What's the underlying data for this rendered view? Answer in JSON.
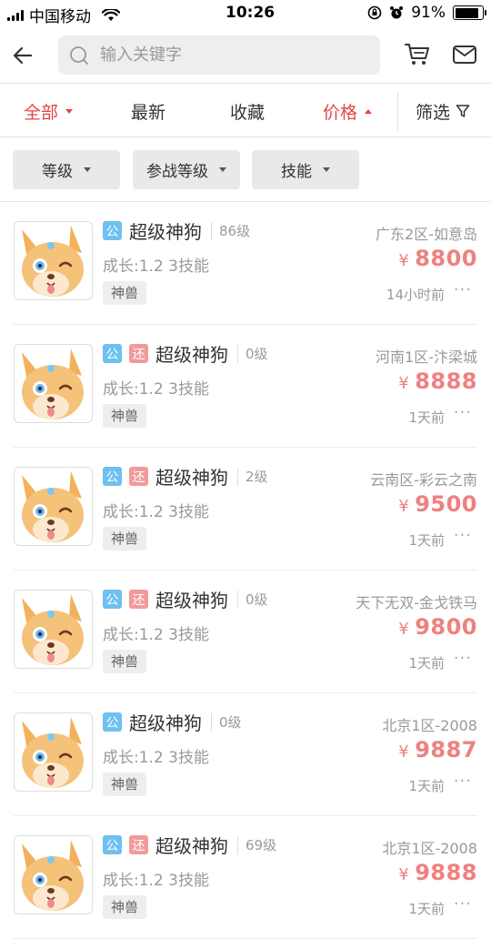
{
  "status_bar": {
    "carrier": "中国移动",
    "time": "10:26",
    "battery": "91%"
  },
  "search": {
    "placeholder": "输入关键字"
  },
  "sort_tabs": [
    {
      "label": "全部",
      "active": true,
      "indicator": "down"
    },
    {
      "label": "最新",
      "active": false
    },
    {
      "label": "收藏",
      "active": false
    },
    {
      "label": "价格",
      "active": true,
      "indicator": "up"
    },
    {
      "label": "筛选",
      "active": false,
      "icon": "funnel-icon"
    }
  ],
  "filters": [
    {
      "label": "等级"
    },
    {
      "label": "参战等级"
    },
    {
      "label": "技能"
    }
  ],
  "colors": {
    "accent": "#e64545",
    "price": "#f08080",
    "badge_gong": "#6ec0f0",
    "badge_huan": "#f29a9a"
  },
  "items": [
    {
      "badges": [
        "公"
      ],
      "name": "超级神狗",
      "level": "86级",
      "server": "广东2区-如意岛",
      "growth": "成长:1.2 3技能",
      "price_symbol": "¥",
      "price": "8800",
      "tag": "神兽",
      "time": "14小时前",
      "more": "···"
    },
    {
      "badges": [
        "公",
        "还"
      ],
      "name": "超级神狗",
      "level": "0级",
      "server": "河南1区-汴梁城",
      "growth": "成长:1.2 3技能",
      "price_symbol": "¥",
      "price": "8888",
      "tag": "神兽",
      "time": "1天前",
      "more": "···"
    },
    {
      "badges": [
        "公",
        "还"
      ],
      "name": "超级神狗",
      "level": "2级",
      "server": "云南区-彩云之南",
      "growth": "成长:1.2 3技能",
      "price_symbol": "¥",
      "price": "9500",
      "tag": "神兽",
      "time": "1天前",
      "more": "···"
    },
    {
      "badges": [
        "公",
        "还"
      ],
      "name": "超级神狗",
      "level": "0级",
      "server": "天下无双-金戈铁马",
      "growth": "成长:1.2 3技能",
      "price_symbol": "¥",
      "price": "9800",
      "tag": "神兽",
      "time": "1天前",
      "more": "···"
    },
    {
      "badges": [
        "公"
      ],
      "name": "超级神狗",
      "level": "0级",
      "server": "北京1区-2008",
      "growth": "成长:1.2 3技能",
      "price_symbol": "¥",
      "price": "9887",
      "tag": "神兽",
      "time": "1天前",
      "more": "···"
    },
    {
      "badges": [
        "公",
        "还"
      ],
      "name": "超级神狗",
      "level": "69级",
      "server": "北京1区-2008",
      "growth": "成长:1.2 3技能",
      "price_symbol": "¥",
      "price": "9888",
      "tag": "神兽",
      "time": "1天前",
      "more": "···"
    }
  ]
}
